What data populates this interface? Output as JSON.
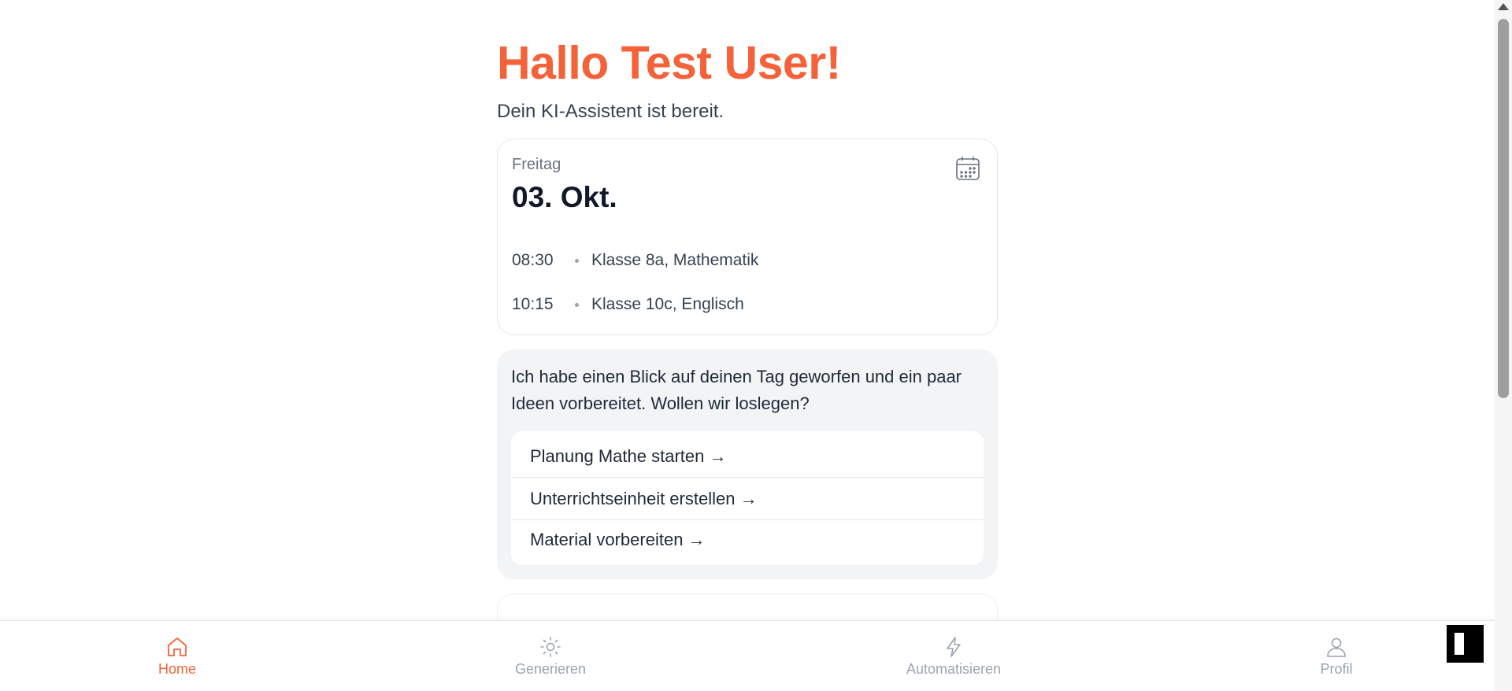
{
  "header": {
    "greeting": "Hallo Test User!",
    "subtitle": "Dein KI-Assistent ist bereit."
  },
  "date_card": {
    "weekday": "Freitag",
    "date": "03. Okt.",
    "icon": "calendar-icon",
    "events": [
      {
        "time": "08:30",
        "label": "Klasse 8a, Mathematik"
      },
      {
        "time": "10:15",
        "label": "Klasse 10c, Englisch"
      }
    ]
  },
  "assistant": {
    "message": "Ich habe einen Blick auf deinen Tag geworfen und ein paar Ideen vorbereitet. Wollen wir loslegen?",
    "actions": [
      {
        "label": "Planung Mathe starten →"
      },
      {
        "label": "Unterrichtseinheit erstellen →"
      },
      {
        "label": "Material vorbereiten →"
      }
    ]
  },
  "bottom_nav": {
    "items": [
      {
        "label": "Home",
        "icon": "home-icon",
        "active": true
      },
      {
        "label": "Generieren",
        "icon": "sun-icon",
        "active": false
      },
      {
        "label": "Automatisieren",
        "icon": "lightning-icon",
        "active": false
      },
      {
        "label": "Profil",
        "icon": "user-icon",
        "active": false
      }
    ]
  },
  "colors": {
    "accent": "#f4623a",
    "muted": "#9ca3af",
    "card_bg": "#f3f4f6"
  }
}
